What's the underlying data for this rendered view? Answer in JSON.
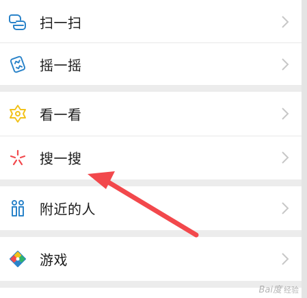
{
  "menu": {
    "items": [
      {
        "label": "扫一扫",
        "icon": "scan-icon"
      },
      {
        "label": "摇一摇",
        "icon": "shake-icon"
      },
      {
        "label": "看一看",
        "icon": "top-stories-icon"
      },
      {
        "label": "搜一搜",
        "icon": "search-icon"
      },
      {
        "label": "附近的人",
        "icon": "people-nearby-icon"
      },
      {
        "label": "游戏",
        "icon": "games-icon"
      }
    ]
  },
  "annotation": {
    "type": "arrow",
    "color": "#f2484c"
  },
  "watermark": {
    "text": "Bai度",
    "sub": "经验"
  },
  "colors": {
    "background": "#ececec",
    "card": "#ffffff",
    "accent_blue": "#2a83c9",
    "accent_yellow": "#f2c21a",
    "accent_red": "#f2484c"
  }
}
